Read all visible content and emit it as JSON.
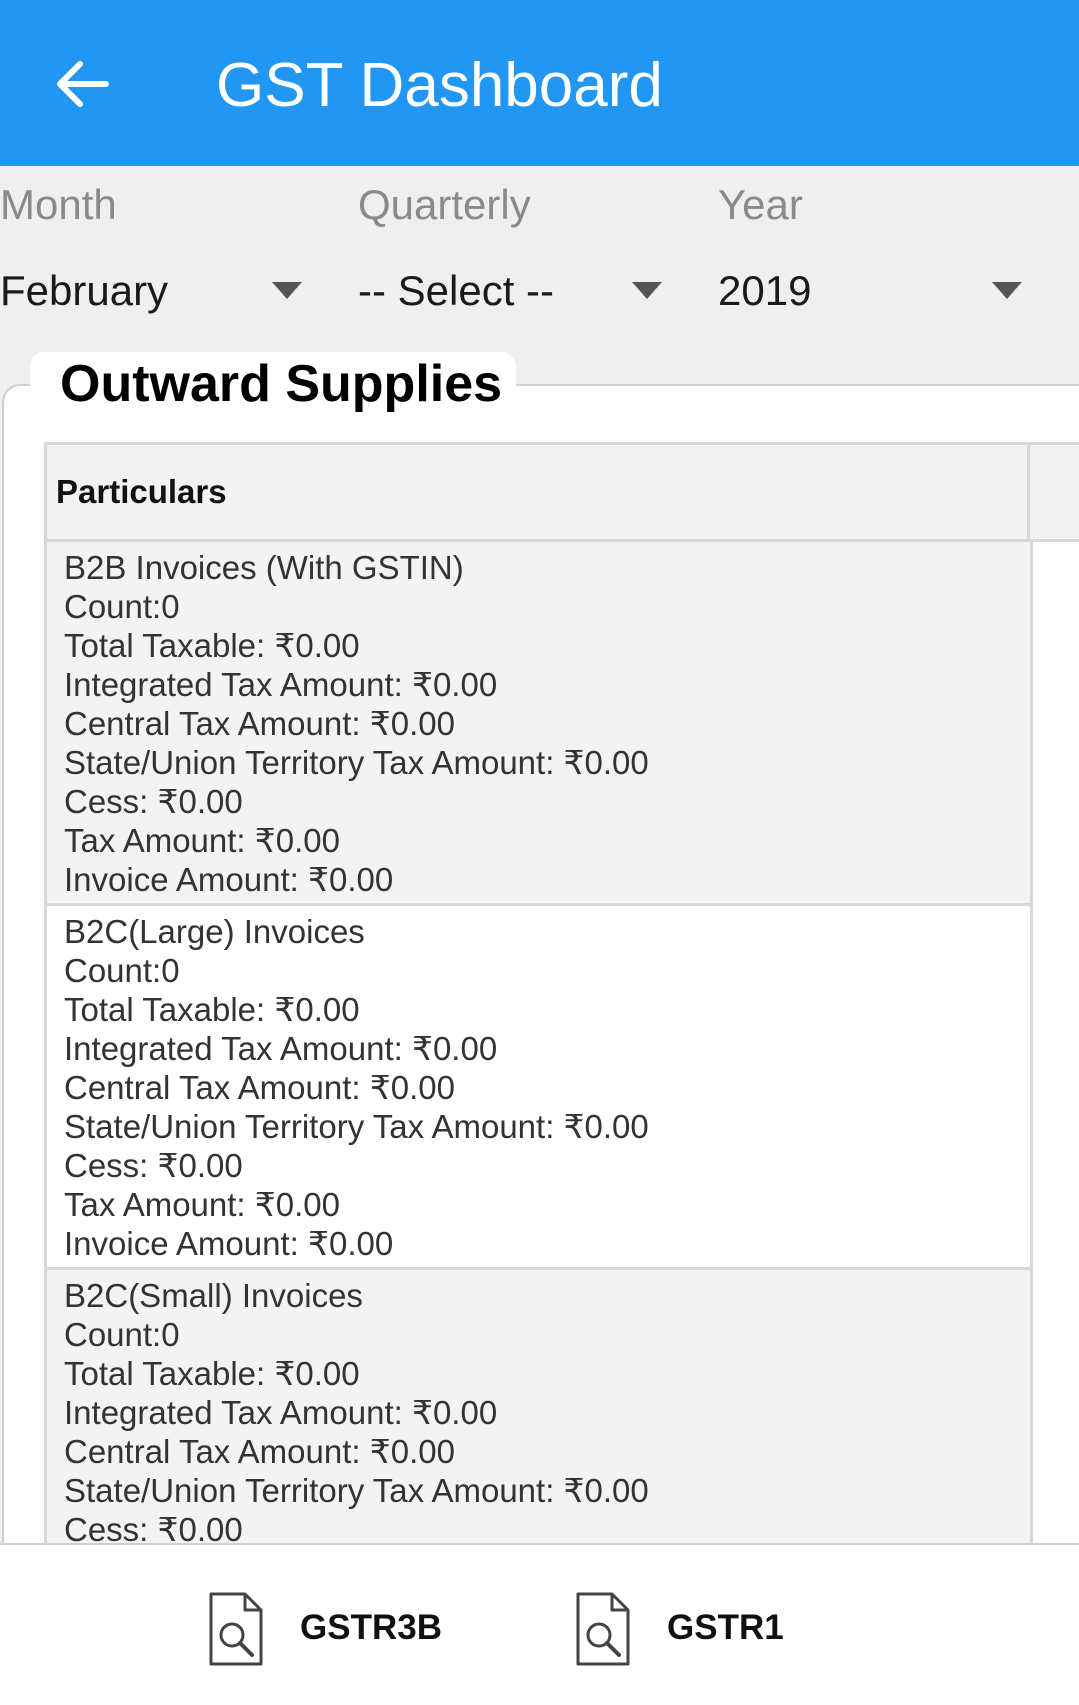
{
  "appbar": {
    "title": "GST Dashboard",
    "color": "#2196f3"
  },
  "filters": {
    "month": {
      "label": "Month",
      "value": "February"
    },
    "quarterly": {
      "label": "Quarterly",
      "value": "-- Select --"
    },
    "year": {
      "label": "Year",
      "value": "2019"
    }
  },
  "outward": {
    "title": "Outward Supplies",
    "header": "Particulars",
    "rows": [
      {
        "name": "B2B Invoices (With GSTIN)",
        "count": "Count:0",
        "total_taxable": "Total Taxable: ₹0.00",
        "integrated_tax": "Integrated Tax Amount: ₹0.00",
        "central_tax": "Central Tax Amount: ₹0.00",
        "state_tax": "State/Union Territory Tax Amount: ₹0.00",
        "cess": "Cess: ₹0.00",
        "tax_amount": "Tax Amount: ₹0.00",
        "invoice_amount": "Invoice Amount: ₹0.00"
      },
      {
        "name": "B2C(Large) Invoices",
        "count": "Count:0",
        "total_taxable": "Total Taxable: ₹0.00",
        "integrated_tax": "Integrated Tax Amount: ₹0.00",
        "central_tax": "Central Tax Amount: ₹0.00",
        "state_tax": "State/Union Territory Tax Amount: ₹0.00",
        "cess": "Cess: ₹0.00",
        "tax_amount": "Tax Amount: ₹0.00",
        "invoice_amount": "Invoice Amount: ₹0.00"
      },
      {
        "name": "B2C(Small) Invoices",
        "count": "Count:0",
        "total_taxable": "Total Taxable: ₹0.00",
        "integrated_tax": "Integrated Tax Amount: ₹0.00",
        "central_tax": "Central Tax Amount: ₹0.00",
        "state_tax": "State/Union Territory Tax Amount: ₹0.00",
        "cess": "Cess: ₹0.00"
      }
    ]
  },
  "bottom_bar": {
    "gstr3b": {
      "label": "GSTR3B",
      "icon": "document-search-icon"
    },
    "gstr1": {
      "label": "GSTR1",
      "icon": "document-search-icon"
    }
  }
}
